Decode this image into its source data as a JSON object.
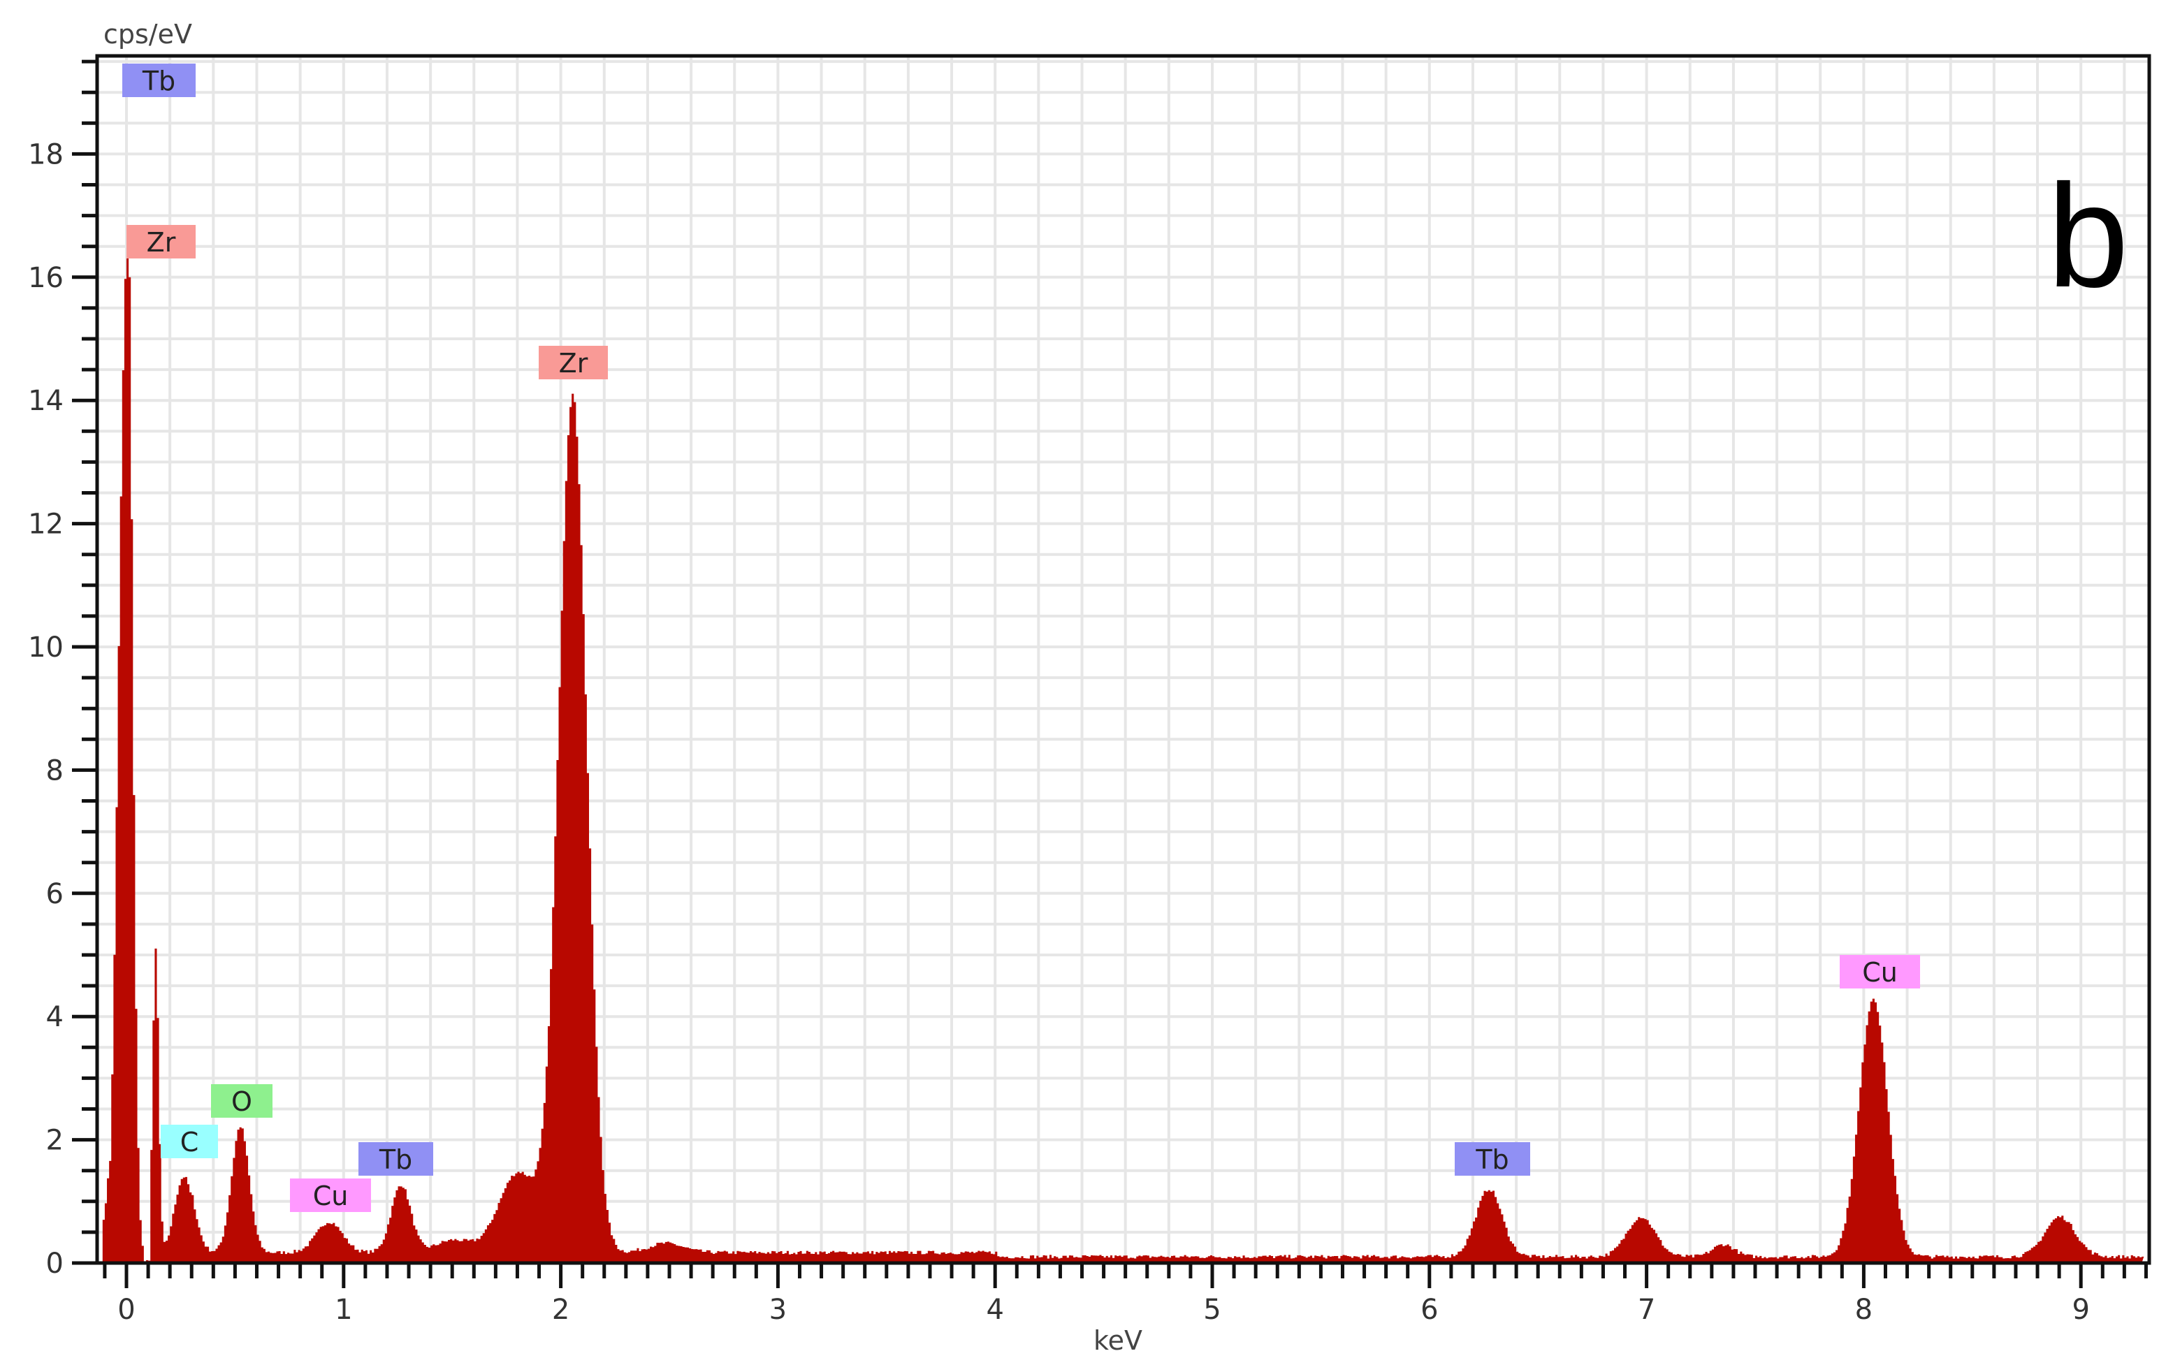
{
  "chart_data": {
    "type": "area",
    "title": "",
    "panel_label": "b",
    "xlabel": "keV",
    "ylabel": "cps/eV",
    "xlim": [
      -0.13,
      9.32
    ],
    "ylim": [
      0,
      19.6
    ],
    "x_ticks": [
      "0",
      "1",
      "2",
      "3",
      "4",
      "5",
      "6",
      "7",
      "8",
      "9"
    ],
    "y_ticks": [
      "0",
      "2",
      "4",
      "6",
      "8",
      "10",
      "12",
      "14",
      "16",
      "18"
    ],
    "grid": true,
    "fill_color": "#b80800",
    "background_cps": 0.17,
    "peaks": [
      {
        "energy": -0.02,
        "height": 12.0,
        "width": 0.03
      },
      {
        "energy": 0.01,
        "height": 7.5,
        "width": 0.02
      },
      {
        "energy": 0.012,
        "height": 1.2,
        "width": 0.006
      },
      {
        "energy": 0.13,
        "height": 5.0,
        "width": 0.014
      },
      {
        "energy": 0.26,
        "height": 1.35,
        "width": 0.045
      },
      {
        "energy": 0.52,
        "height": 2.05,
        "width": 0.04
      },
      {
        "energy": 0.93,
        "height": 0.5,
        "width": 0.06
      },
      {
        "energy": 1.26,
        "height": 1.1,
        "width": 0.045
      },
      {
        "energy": 1.5,
        "height": 0.2,
        "width": 0.08
      },
      {
        "energy": 1.8,
        "height": 1.3,
        "width": 0.09
      },
      {
        "energy": 2.05,
        "height": 13.9,
        "width": 0.065
      },
      {
        "energy": 2.48,
        "height": 0.15,
        "width": 0.08
      },
      {
        "energy": 6.27,
        "height": 1.1,
        "width": 0.06
      },
      {
        "energy": 6.97,
        "height": 0.65,
        "width": 0.065
      },
      {
        "energy": 7.35,
        "height": 0.2,
        "width": 0.05
      },
      {
        "energy": 8.04,
        "height": 4.2,
        "width": 0.065
      },
      {
        "energy": 8.9,
        "height": 0.65,
        "width": 0.07
      }
    ],
    "annotations": [
      {
        "text": "Tb",
        "energy": 0.0,
        "color": "#9090f4"
      },
      {
        "text": "Zr",
        "energy": 0.0,
        "color": "#f99a96"
      },
      {
        "text": "Zr",
        "energy": 2.04,
        "color": "#f99a96"
      },
      {
        "text": "C",
        "energy": 0.27,
        "color": "#99ffff"
      },
      {
        "text": "O",
        "energy": 0.52,
        "color": "#8ef08e"
      },
      {
        "text": "Cu",
        "energy": 0.93,
        "color": "#ff99ff"
      },
      {
        "text": "Tb",
        "energy": 1.27,
        "color": "#9090f4"
      },
      {
        "text": "Tb",
        "energy": 6.27,
        "color": "#9090f4"
      },
      {
        "text": "Cu",
        "energy": 8.04,
        "color": "#ff99ff"
      }
    ]
  }
}
